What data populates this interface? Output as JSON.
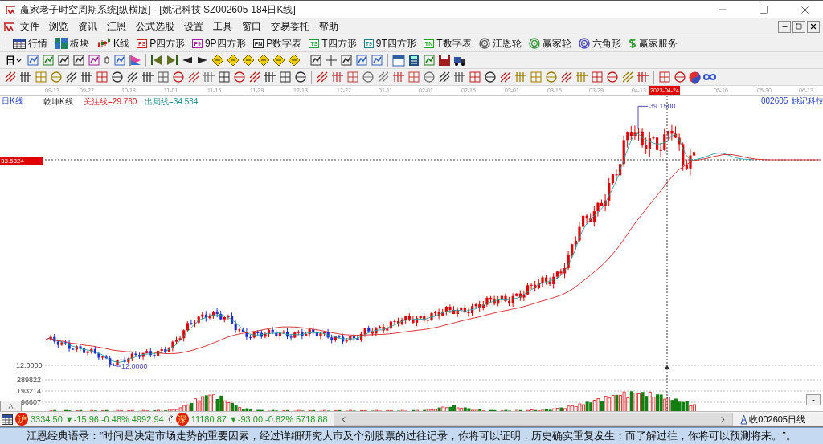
{
  "window": {
    "title": "赢家老子时空周期系统[纵横版] - [姚记科技  SZ002605-184日K线]"
  },
  "menu": [
    "文件",
    "浏览",
    "资讯",
    "江恩",
    "公式选股",
    "设置",
    "工具",
    "窗口",
    "交易委托",
    "帮助"
  ],
  "toolbar": [
    {
      "kind": "grid",
      "label": "行情"
    },
    {
      "kind": "blocks",
      "label": "板块"
    },
    {
      "kind": "kline",
      "label": "K线"
    },
    {
      "kind": "badge",
      "badge": "PS",
      "label": "P四方形",
      "color": "#d02020"
    },
    {
      "kind": "badge",
      "badge": "P9",
      "label": "9P四方形",
      "color": "#a020a0"
    },
    {
      "kind": "badge",
      "badge": "PN",
      "label": "P数字表",
      "color": "#202020"
    },
    {
      "kind": "badge",
      "badge": "TS",
      "label": "T四方形",
      "color": "#20a040"
    },
    {
      "kind": "badge",
      "badge": "T9",
      "label": "9T四方形",
      "color": "#208080"
    },
    {
      "kind": "badge",
      "badge": "TN",
      "label": "T数字表",
      "color": "#20a020"
    },
    {
      "kind": "wheel",
      "label": "江恩轮",
      "color": "#606060"
    },
    {
      "kind": "wheel",
      "label": "赢家轮",
      "color": "#3a9a3a"
    },
    {
      "kind": "wheel",
      "label": "六角形",
      "color": "#5050c0"
    },
    {
      "kind": "dollar",
      "label": "赢家服务"
    }
  ],
  "period_selector": "日",
  "chart": {
    "period_label": "日K线",
    "indicator": "乾坤K线",
    "focus_line": "关注线=29.760",
    "exit_line": "出局线=34.534",
    "code": "002605",
    "name": "姚记科技",
    "dates": [
      {
        "label": "09-13",
        "selected": false
      },
      {
        "label": "09-27",
        "selected": false
      },
      {
        "label": "10-18",
        "selected": false
      },
      {
        "label": "11-01",
        "selected": false
      },
      {
        "label": "11-15",
        "selected": false
      },
      {
        "label": "11-29",
        "selected": false
      },
      {
        "label": "12-13",
        "selected": false
      },
      {
        "label": "12-27",
        "selected": false
      },
      {
        "label": "01-11",
        "selected": false
      },
      {
        "label": "02-01",
        "selected": false
      },
      {
        "label": "02-15",
        "selected": false
      },
      {
        "label": "03-01",
        "selected": false
      },
      {
        "label": "03-15",
        "selected": false
      },
      {
        "label": "03-29",
        "selected": false
      },
      {
        "label": "04-13",
        "selected": false
      },
      {
        "label": "2023-04-24",
        "selected": true
      },
      {
        "label": "05-16",
        "selected": false
      },
      {
        "label": "05-30",
        "selected": false
      },
      {
        "label": "06-13",
        "selected": false
      }
    ],
    "current_price": "33.5824",
    "price_axis": "12.0000",
    "high_label": "39.1500",
    "low_label": "12.0000",
    "volume_axis": [
      "289822",
      "193214",
      "96607"
    ],
    "expand_button": "△",
    "collapse_button": "-"
  },
  "status_bar": {
    "indices": [
      {
        "badge": "沪",
        "text": "3334.50 ▼-15.96 -0.48% 4992.94"
      },
      {
        "badge": "深",
        "text": "11180.87 ▼-93.00 -0.82% 5718.88"
      }
    ],
    "tab": "收002605日线"
  },
  "quote": "江恩经典语录：“时间是决定市场走势的重要因素，经过详细研究大市及个别股票的过往记录，你将可以证明，历史确实重复发生；而了解过往，你将可以预测将来。”。"
}
